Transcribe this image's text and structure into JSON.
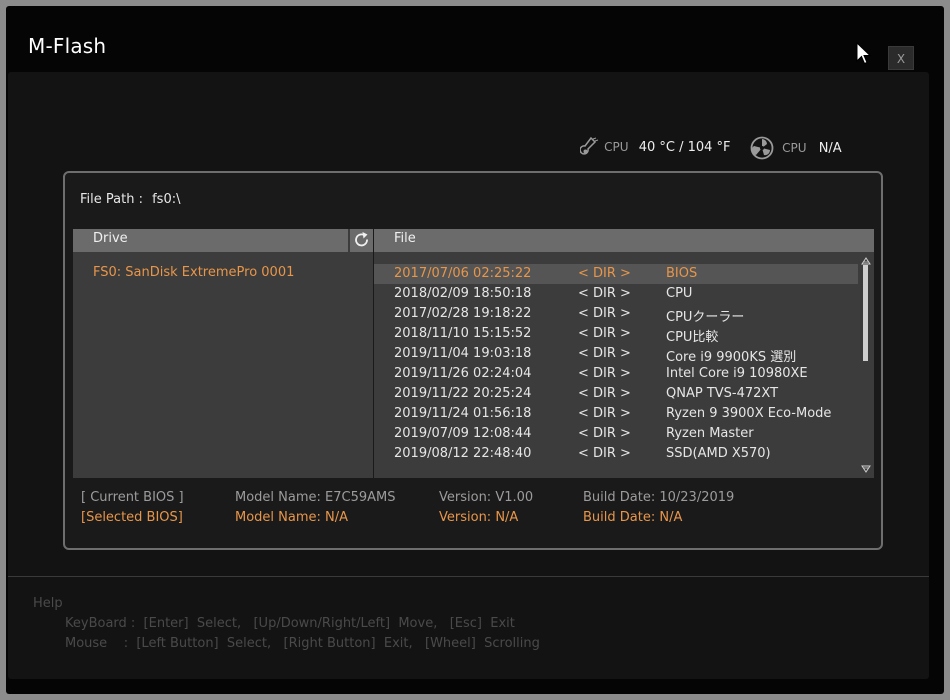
{
  "window": {
    "title": "M-Flash",
    "close_label": "X"
  },
  "status": {
    "temp_label": "CPU",
    "temp_value": "40 °C / 104 °F",
    "fan_label": "CPU",
    "fan_value": "N/A"
  },
  "file_path": {
    "label": "File Path :",
    "value": "fs0:\\"
  },
  "drive_panel": {
    "header": "Drive",
    "items": [
      "FS0: SanDisk ExtremePro 0001"
    ]
  },
  "file_panel": {
    "header": "File",
    "rows": [
      {
        "date": "2017/07/06 02:25:22",
        "type": "< DIR >",
        "name": "BIOS",
        "selected": true
      },
      {
        "date": "2018/02/09 18:50:18",
        "type": "< DIR >",
        "name": "CPU"
      },
      {
        "date": "2017/02/28 19:18:22",
        "type": "< DIR >",
        "name": "CPUクーラー"
      },
      {
        "date": "2018/11/10 15:15:52",
        "type": "< DIR >",
        "name": "CPU比較"
      },
      {
        "date": "2019/11/04 19:03:18",
        "type": "< DIR >",
        "name": "Core i9 9900KS 選別"
      },
      {
        "date": "2019/11/26 02:24:04",
        "type": "< DIR >",
        "name": "Intel Core i9 10980XE"
      },
      {
        "date": "2019/11/22 20:25:24",
        "type": "< DIR >",
        "name": "QNAP TVS-472XT"
      },
      {
        "date": "2019/11/24 01:56:18",
        "type": "< DIR >",
        "name": "Ryzen 9 3900X Eco-Mode"
      },
      {
        "date": "2019/07/09 12:08:44",
        "type": "< DIR >",
        "name": "Ryzen Master"
      },
      {
        "date": "2019/08/12 22:48:40",
        "type": "< DIR >",
        "name": "SSD(AMD X570)"
      }
    ]
  },
  "bios_info": {
    "current": {
      "label": "[ Current BIOS  ]",
      "model": "Model Name: E7C59AMS",
      "version": "Version: V1.00",
      "build": "Build Date: 10/23/2019"
    },
    "selected": {
      "label": "[Selected BIOS]",
      "model": "Model Name: N/A",
      "version": "Version: N/A",
      "build": "Build Date: N/A"
    }
  },
  "help": {
    "title": "Help",
    "keyboard": "KeyBoard :  [Enter]  Select,   [Up/Down/Right/Left]  Move,   [Esc]  Exit",
    "mouse": "Mouse    :  [Left Button]  Select,   [Right Button]  Exit,   [Wheel]  Scrolling"
  },
  "colors": {
    "accent": "#e8964a",
    "header_bg": "#6b6b6b",
    "list_bg": "#3c3c3c",
    "window_bg": "#050505"
  },
  "icons": [
    "thermometer-icon",
    "fan-icon",
    "refresh-icon",
    "cursor-icon",
    "scroll-up-icon",
    "scroll-down-icon"
  ]
}
